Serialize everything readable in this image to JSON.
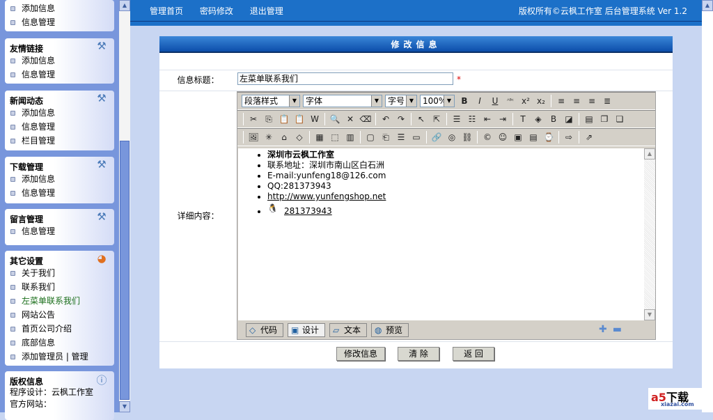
{
  "sidebar": {
    "p1": {
      "items": [
        "添加信息",
        "信息管理"
      ]
    },
    "p2": {
      "title": "友情链接",
      "items": [
        "添加信息",
        "信息管理"
      ]
    },
    "p3": {
      "title": "新闻动态",
      "items": [
        "添加信息",
        "信息管理",
        "栏目管理"
      ]
    },
    "p4": {
      "title": "下载管理",
      "items": [
        "添加信息",
        "信息管理"
      ]
    },
    "p5": {
      "title": "留言管理",
      "items": [
        "信息管理"
      ]
    },
    "p6": {
      "title": "其它设置",
      "items": [
        "关于我们",
        "联系我们",
        "左菜单联系我们",
        "网站公告",
        "首页公司介绍",
        "底部信息",
        "添加管理员 | 管理"
      ]
    },
    "p7": {
      "title": "版权信息",
      "lines": [
        "程序设计：云枫工作室",
        "官方网站："
      ]
    }
  },
  "topbar": {
    "nav": [
      "管理首页",
      "密码修改",
      "退出管理"
    ],
    "copyright": "版权所有©云枫工作室  后台管理系统 Ver 1.2"
  },
  "panel": {
    "title": "修改信息",
    "title_label": "信息标题：",
    "title_value": "左菜单联系我们",
    "content_label": "详细内容："
  },
  "editor": {
    "selects": [
      "段落样式",
      "字体",
      "字号",
      "100%"
    ],
    "content": {
      "company": "深圳市云枫工作室",
      "address": "联系地址：深圳市南山区白石洲",
      "email": "E-mail:yunfeng18@126.com",
      "qq": "QQ:281373943",
      "url": "http://www.yunfengshop.net",
      "qq_link": "281373943"
    },
    "tabs": [
      "代码",
      "设计",
      "文本",
      "预览"
    ]
  },
  "buttons": {
    "submit": "修改信息",
    "clear": "清 除",
    "back": "返 回"
  },
  "watermark": {
    "brand": "下载",
    "site": "xiazai.com"
  }
}
